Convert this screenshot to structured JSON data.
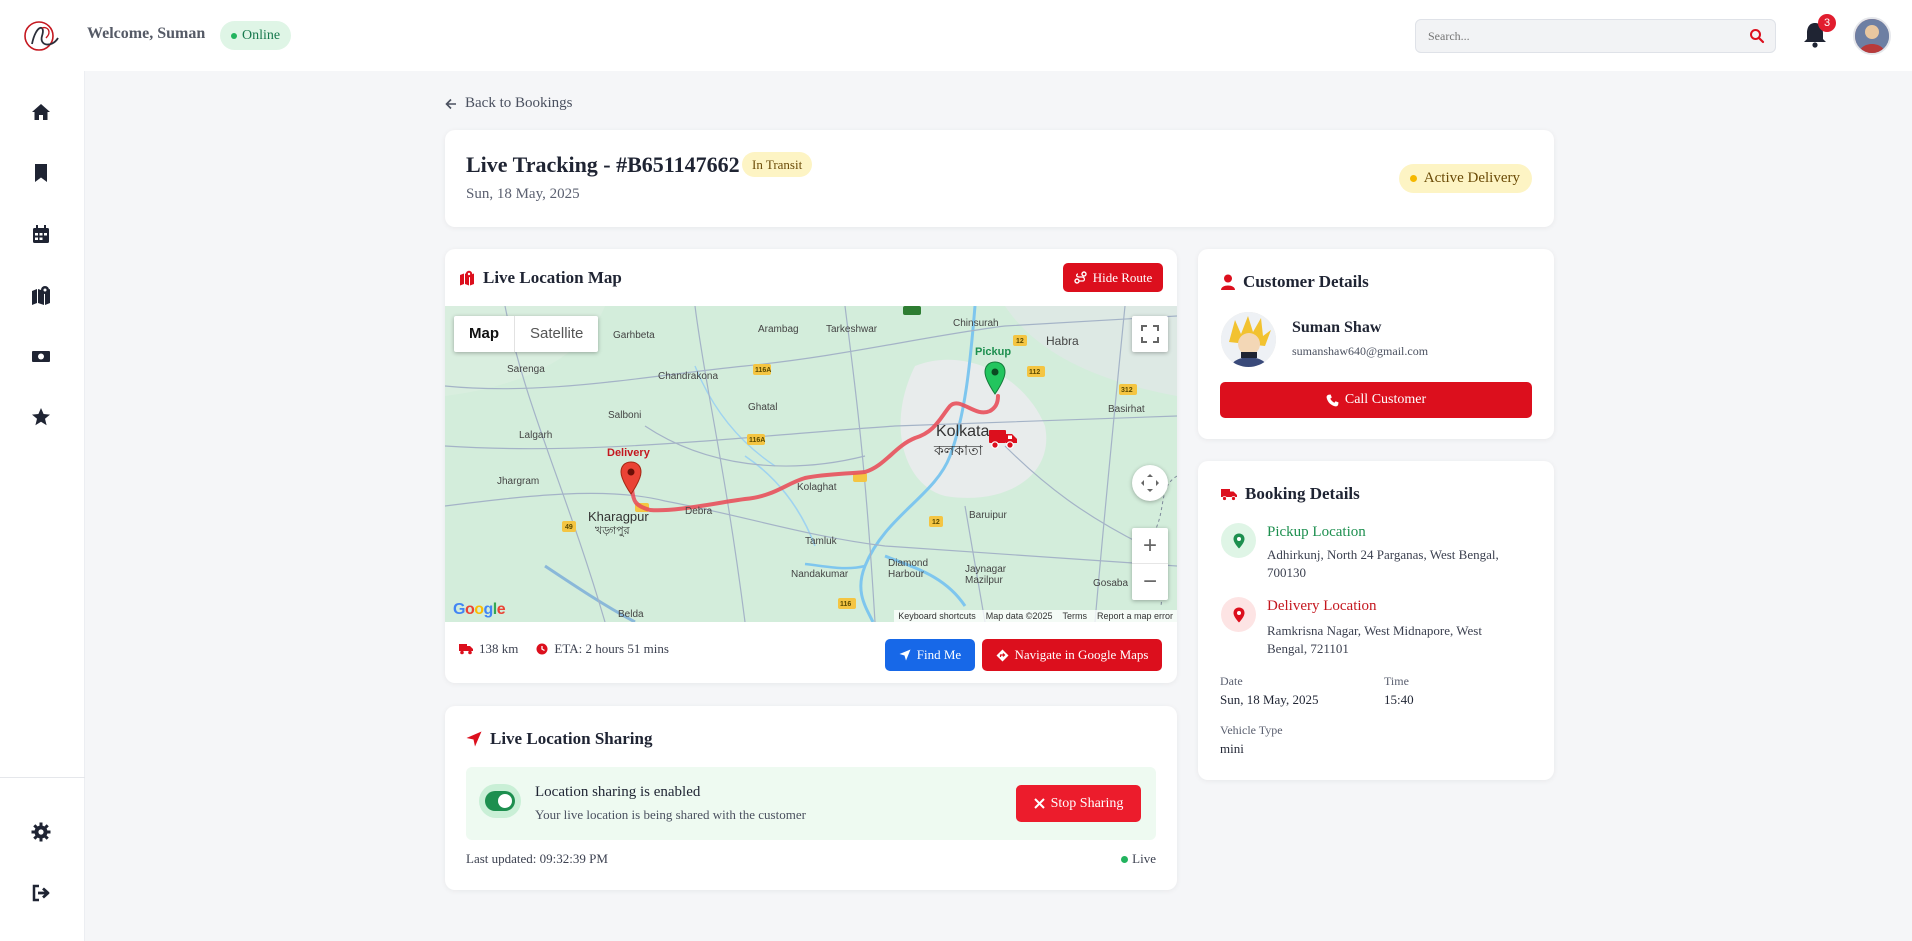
{
  "topbar": {
    "welcome": "Welcome, Suman",
    "status": "Online",
    "search_placeholder": "Search...",
    "notification_count": "3"
  },
  "sidebar": {
    "items": [
      "home-icon",
      "bookmark-icon",
      "calendar-icon",
      "map-icon",
      "money-icon",
      "star-icon"
    ],
    "bottom": [
      "gear-icon",
      "logout-icon"
    ]
  },
  "page": {
    "back_label": "Back to Bookings",
    "title": "Live Tracking - #B651147662",
    "status_badge": "In Transit",
    "date": "Sun, 18 May, 2025",
    "active_badge": "Active Delivery"
  },
  "map_section": {
    "title": "Live Location Map",
    "hide_route_label": "Hide Route",
    "map_type": [
      "Map",
      "Satellite"
    ],
    "labels": {
      "pickup": "Pickup",
      "delivery": "Delivery",
      "kolkata": "Kolkata",
      "kolkata_bn": "কলকাতা",
      "kharagpur": "Kharagpur",
      "kharagpur_bn": "খড়্গপুর",
      "garhbeta": "Garhbeta",
      "arambag": "Arambag",
      "tarkeshwar": "Tarkeshwar",
      "chinsurah": "Chinsurah",
      "habra": "Habra",
      "sarenga": "Sarenga",
      "chandrakona": "Chandrakona",
      "salboni": "Salboni",
      "lalgarh": "Lalgarh",
      "ghatal": "Ghatal",
      "basirhat": "Basirhat",
      "jhargram": "Jhargram",
      "debra": "Debra",
      "kolaghat": "Kolaghat",
      "tamluk": "Tamluk",
      "baruipur": "Baruipur",
      "nandakumar": "Nandakumar",
      "diamond_harbour": "Diamond Harbour",
      "jaynagar": "Jaynagar Mazilpur",
      "gosaba": "Gosaba",
      "belda": "Belda"
    },
    "attribution": [
      "Keyboard shortcuts",
      "Map data ©2025",
      "Terms",
      "Report a map error"
    ],
    "google": "Google",
    "distance": "138 km",
    "eta": "ETA: 2 hours 51 mins",
    "find_me_label": "Find Me",
    "navigate_label": "Navigate in Google Maps",
    "route_color": "#e8505b"
  },
  "sharing": {
    "title": "Live Location Sharing",
    "heading": "Location sharing is enabled",
    "sub": "Your live location is being shared with the customer",
    "stop_label": "Stop Sharing",
    "last_updated": "Last updated: 09:32:39 PM",
    "live_label": "Live"
  },
  "customer": {
    "title": "Customer Details",
    "name": "Suman Shaw",
    "email": "sumanshaw640@gmail.com",
    "call_label": "Call Customer"
  },
  "booking": {
    "title": "Booking Details",
    "pickup_title": "Pickup Location",
    "pickup_address": "Adhirkunj, North 24 Parganas, West Bengal, 700130",
    "delivery_title": "Delivery Location",
    "delivery_address": "Ramkrisna Nagar, West Midnapore, West Bengal, 721101",
    "date_label": "Date",
    "date_value": "Sun, 18 May, 2025",
    "time_label": "Time",
    "time_value": "15:40",
    "vehicle_label": "Vehicle Type",
    "vehicle_value": "mini"
  },
  "colors": {
    "brand_red": "#dc0f1d",
    "blue": "#1768e8",
    "green": "#1d8f4f",
    "pickup_green": "#1d8f4f",
    "delivery_red": "#c4171f"
  }
}
